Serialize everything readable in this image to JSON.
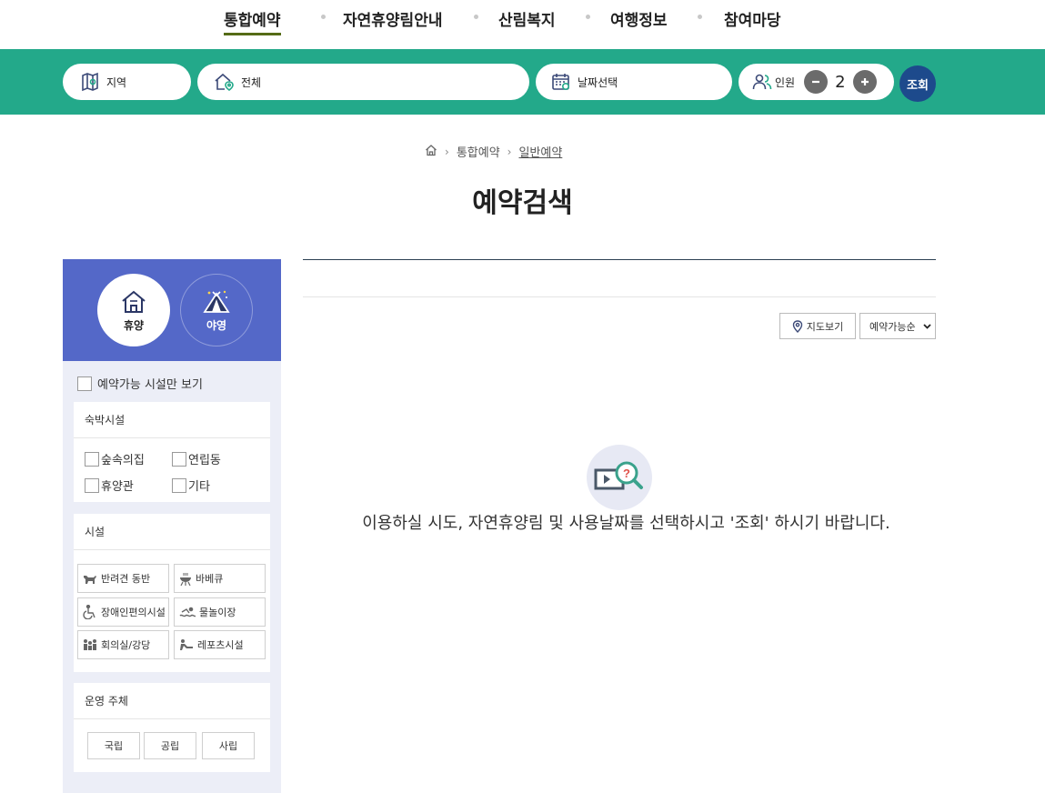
{
  "nav": {
    "items": [
      {
        "label": "통합예약",
        "active": true
      },
      {
        "label": "자연휴양림안내",
        "active": false
      },
      {
        "label": "산림복지",
        "active": false
      },
      {
        "label": "여행정보",
        "active": false
      },
      {
        "label": "참여마당",
        "active": false
      }
    ]
  },
  "search": {
    "region_label": "지역",
    "forest_label": "전체",
    "date_label": "날짜선택",
    "people_label": "인원",
    "people_count": "2",
    "submit_label": "조회",
    "icons": [
      "map-icon",
      "home-pin-icon",
      "calendar-icon",
      "people-icon",
      "minus-icon",
      "plus-icon"
    ]
  },
  "breadcrumb": {
    "items": [
      "통합예약",
      "일반예약"
    ]
  },
  "page_title": "예약검색",
  "sidebar": {
    "types": [
      "휴양",
      "야영"
    ],
    "available_only_label": "예약가능 시설만 보기",
    "lodging": {
      "title": "숙박시설",
      "options": [
        "숲속의집",
        "연립동",
        "휴양관",
        "기타"
      ]
    },
    "facilities": {
      "title": "시설",
      "options": [
        "반려견 동반",
        "바베큐",
        "장애인편의시설",
        "물놀이장",
        "회의실/강당",
        "레포츠시설"
      ]
    },
    "operator": {
      "title": "운영 주체",
      "options": [
        "국립",
        "공립",
        "사립"
      ]
    }
  },
  "results": {
    "map_view_label": "지도보기",
    "sort_label": "예약가능순",
    "empty_message": "이용하실 시도, 자연휴양림 및 사용날짜를 선택하시고 '조회' 하시기 바랍니다."
  },
  "colors": {
    "search_bar": "#23a98a",
    "nav_underline": "#556b16",
    "submit": "#1d4a8c",
    "sidebar_head": "#5468c8",
    "sidebar_bg": "#eceef7"
  }
}
